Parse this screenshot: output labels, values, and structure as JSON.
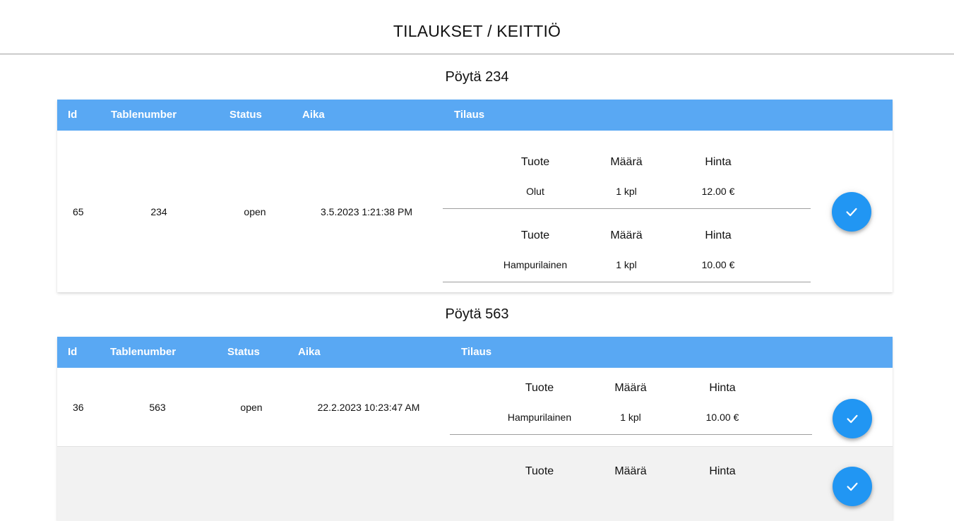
{
  "header": {
    "title": "TILAUKSET / KEITTIÖ"
  },
  "columns": {
    "id": "Id",
    "tablenumber": "Tablenumber",
    "status": "Status",
    "aika": "Aika",
    "tilaus": "Tilaus"
  },
  "item_headers": {
    "tuote": "Tuote",
    "maara": "Määrä",
    "hinta": "Hinta"
  },
  "tables": [
    {
      "title": "Pöytä 234",
      "orders": [
        {
          "id": "65",
          "tablenumber": "234",
          "status": "open",
          "aika": "3.5.2023 1:21:38 PM",
          "items": [
            {
              "tuote": "Olut",
              "maara": "1 kpl",
              "hinta": "12.00 €"
            },
            {
              "tuote": "Hampurilainen",
              "maara": "1 kpl",
              "hinta": "10.00 €"
            }
          ]
        }
      ]
    },
    {
      "title": "Pöytä 563",
      "orders": [
        {
          "id": "36",
          "tablenumber": "563",
          "status": "open",
          "aika": "22.2.2023 10:23:47 AM",
          "items": [
            {
              "tuote": "Hampurilainen",
              "maara": "1 kpl",
              "hinta": "10.00 €"
            }
          ]
        },
        {
          "id": "",
          "tablenumber": "",
          "status": "",
          "aika": "",
          "items": [
            {
              "tuote": "",
              "maara": "",
              "hinta": ""
            }
          ]
        }
      ]
    }
  ],
  "icons": {
    "done": "check-icon"
  },
  "colors": {
    "header_bg": "#59a8f3",
    "button_bg": "#2196f3",
    "alt_row_bg": "#f2f2f2"
  }
}
